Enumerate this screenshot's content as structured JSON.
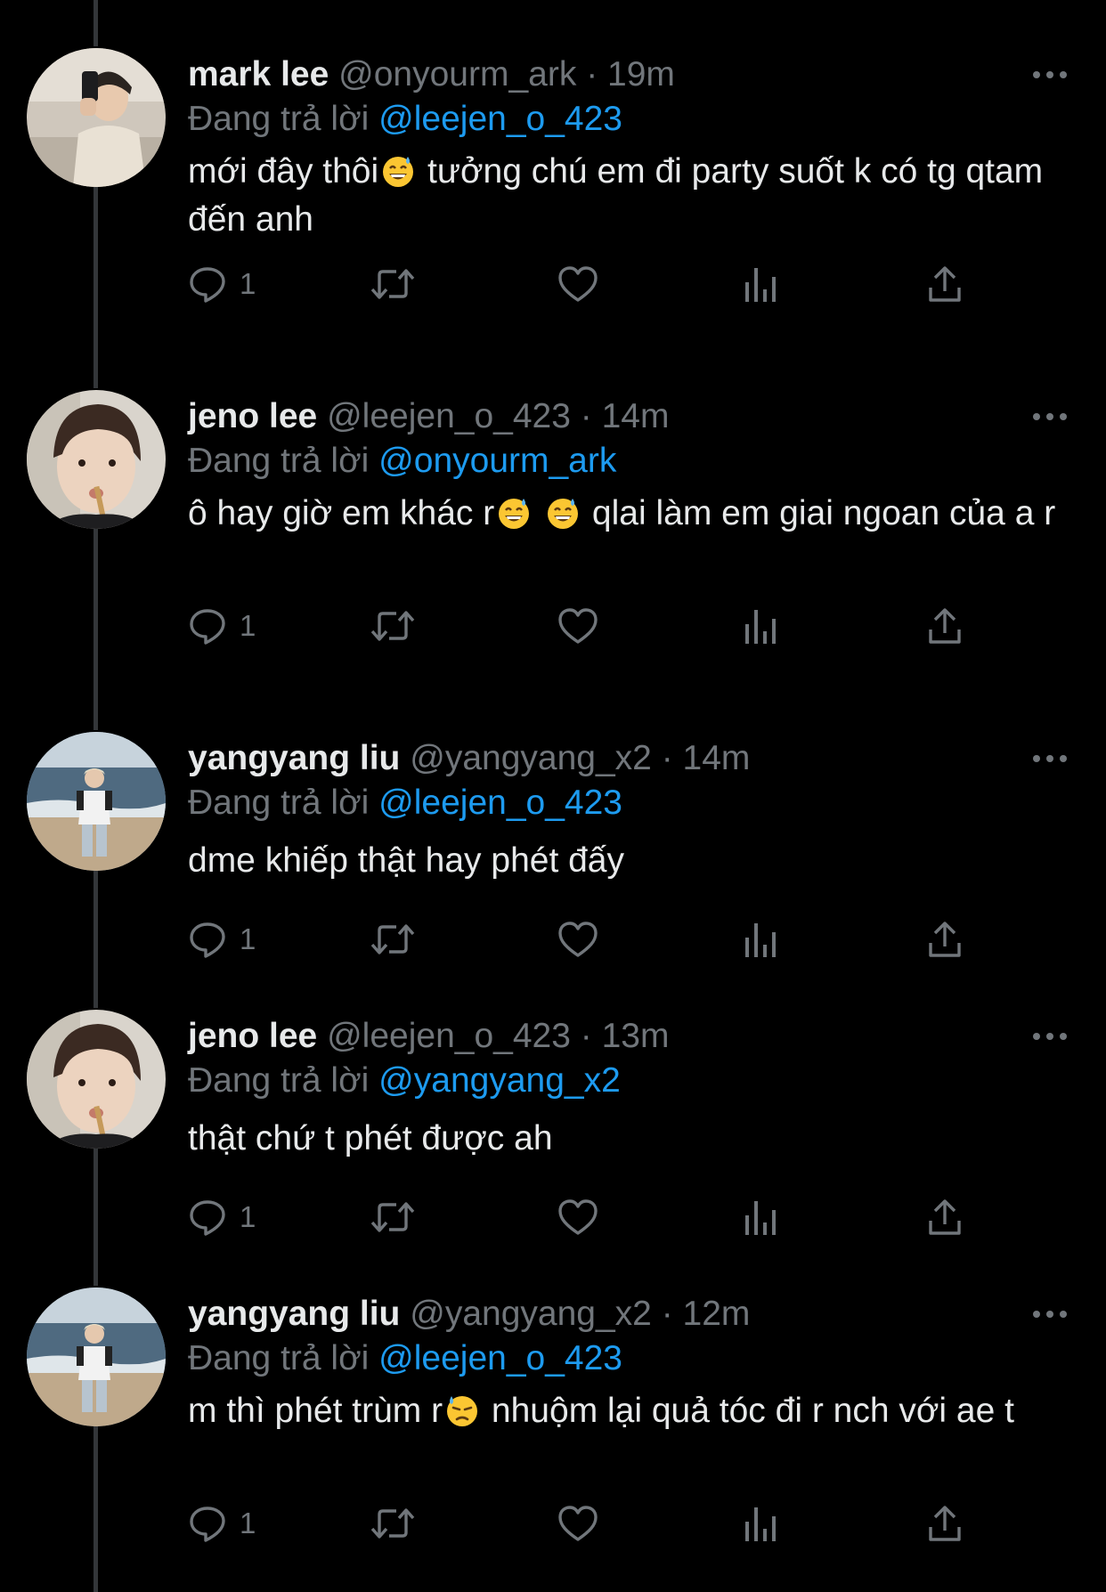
{
  "colors": {
    "background": "#000000",
    "primary_text": "#e7e9ea",
    "secondary_text": "#71767b",
    "link": "#1d9bf0",
    "thread_line": "#333639"
  },
  "icons": {
    "reply": "speech-bubble-icon",
    "retweet": "retweet-icon",
    "like": "heart-icon",
    "views": "bar-chart-icon",
    "share": "share-upload-icon",
    "more": "more-dots-icon",
    "emoji_sweat_smile": "grinning-face-with-sweat-emoji",
    "emoji_downcast_sweat": "downcast-face-with-sweat-emoji"
  },
  "tweets": [
    {
      "display_name": "mark lee",
      "handle": "@onyourm_ark",
      "separator": "·",
      "time": "19m",
      "replying_prefix": "Đang trả lời",
      "replying_to": "@leejen_o_423",
      "text_before_emoji": "mới đây thôi",
      "text_after_emoji": " tưởng chú em đi party suốt k có tg qtam đến anh",
      "reply_count": "1"
    },
    {
      "display_name": "jeno lee",
      "handle": "@leejen_o_423",
      "separator": "·",
      "time": "14m",
      "replying_prefix": "Đang trả lời",
      "replying_to": "@onyourm_ark",
      "text_before_emoji": "ô hay giờ em khác r",
      "text_between_emoji": " ",
      "text_after_emoji": " qlai làm em giai ngoan của a r",
      "reply_count": "1"
    },
    {
      "display_name": "yangyang liu",
      "handle": "@yangyang_x2",
      "separator": "·",
      "time": "14m",
      "replying_prefix": "Đang trả lời",
      "replying_to": "@leejen_o_423",
      "text": "dme khiếp thật hay phét đấy",
      "reply_count": "1"
    },
    {
      "display_name": "jeno lee",
      "handle": "@leejen_o_423",
      "separator": "·",
      "time": "13m",
      "replying_prefix": "Đang trả lời",
      "replying_to": "@yangyang_x2",
      "text": "thật chứ t phét được ah",
      "reply_count": "1"
    },
    {
      "display_name": "yangyang liu",
      "handle": "@yangyang_x2",
      "separator": "·",
      "time": "12m",
      "replying_prefix": "Đang trả lời",
      "replying_to": "@leejen_o_423",
      "text_before_emoji": "m thì phét trùm r",
      "text_after_emoji": " nhuộm lại quả tóc đi r nch với ae t",
      "reply_count": "1"
    }
  ]
}
